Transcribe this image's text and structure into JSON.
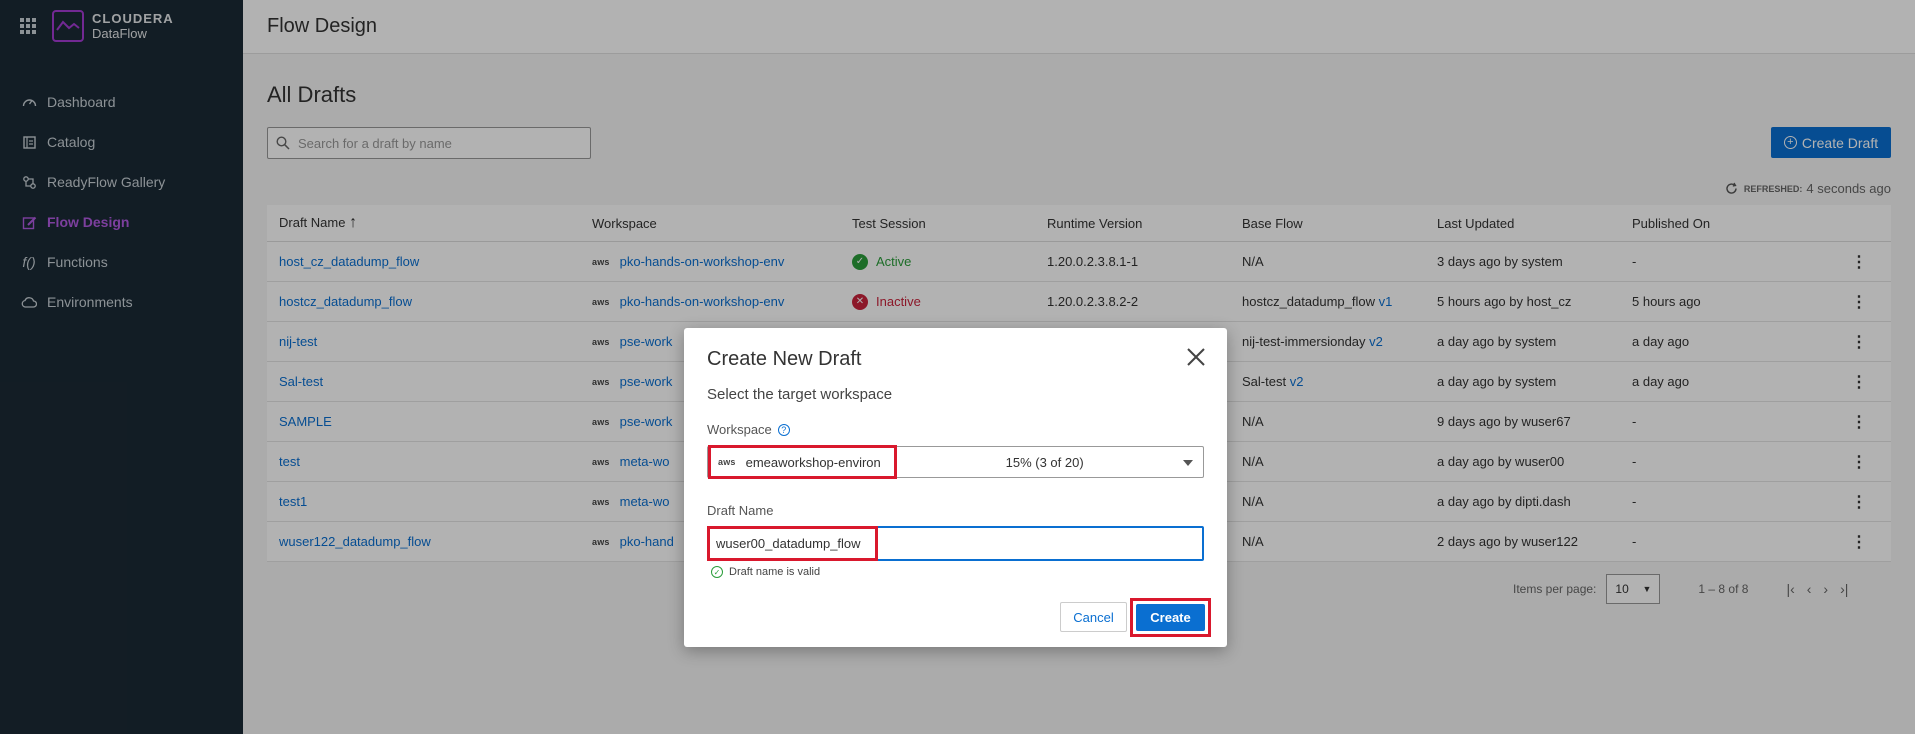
{
  "brand": {
    "name": "CLOUDERA",
    "product": "DataFlow"
  },
  "nav": [
    {
      "label": "Dashboard",
      "icon": "dashboard-icon"
    },
    {
      "label": "Catalog",
      "icon": "catalog-icon"
    },
    {
      "label": "ReadyFlow Gallery",
      "icon": "readyflow-icon"
    },
    {
      "label": "Flow Design",
      "icon": "flow-design-icon",
      "active": true
    },
    {
      "label": "Functions",
      "icon": "functions-icon"
    },
    {
      "label": "Environments",
      "icon": "cloud-icon"
    }
  ],
  "header": {
    "title": "Flow Design"
  },
  "section": {
    "title": "All Drafts"
  },
  "search": {
    "placeholder": "Search for a draft by name"
  },
  "create_draft_button": "Create Draft",
  "refreshed": {
    "label": "REFRESHED:",
    "value": "4 seconds ago"
  },
  "table": {
    "headers": [
      "Draft Name",
      "Workspace",
      "Test Session",
      "Runtime Version",
      "Base Flow",
      "Last Updated",
      "Published On"
    ],
    "sort_indicator": "↑",
    "rows": [
      {
        "name": "host_cz_datadump_flow",
        "workspace": "pko-hands-on-workshop-env",
        "test_session": "Active",
        "status": "active",
        "runtime": "1.20.0.2.3.8.1-1",
        "base_flow": "N/A",
        "base_flow_version": "",
        "last_updated": "3 days ago by system",
        "published_on": "-"
      },
      {
        "name": "hostcz_datadump_flow",
        "workspace": "pko-hands-on-workshop-env",
        "test_session": "Inactive",
        "status": "inactive",
        "runtime": "1.20.0.2.3.8.2-2",
        "base_flow": "hostcz_datadump_flow",
        "base_flow_version": "v1",
        "last_updated": "5 hours ago by host_cz",
        "published_on": "5 hours ago"
      },
      {
        "name": "nij-test",
        "workspace": "pse-work",
        "test_session": "",
        "status": "",
        "runtime": "",
        "base_flow": "nij-test-immersionday",
        "base_flow_version": "v2",
        "last_updated": "a day ago by system",
        "published_on": "a day ago"
      },
      {
        "name": "Sal-test",
        "workspace": "pse-work",
        "test_session": "",
        "status": "",
        "runtime": "",
        "base_flow": "Sal-test",
        "base_flow_version": "v2",
        "last_updated": "a day ago by system",
        "published_on": "a day ago"
      },
      {
        "name": "SAMPLE",
        "workspace": "pse-work",
        "test_session": "",
        "status": "",
        "runtime": "",
        "base_flow": "N/A",
        "base_flow_version": "",
        "last_updated": "9 days ago by wuser67",
        "published_on": "-"
      },
      {
        "name": "test",
        "workspace": "meta-wo",
        "test_session": "",
        "status": "",
        "runtime": "",
        "base_flow": "N/A",
        "base_flow_version": "",
        "last_updated": "a day ago by wuser00",
        "published_on": "-"
      },
      {
        "name": "test1",
        "workspace": "meta-wo",
        "test_session": "",
        "status": "",
        "runtime": "",
        "base_flow": "N/A",
        "base_flow_version": "",
        "last_updated": "a day ago by dipti.dash",
        "published_on": "-"
      },
      {
        "name": "wuser122_datadump_flow",
        "workspace": "pko-hand",
        "test_session": "",
        "status": "",
        "runtime": "",
        "base_flow": "N/A",
        "base_flow_version": "",
        "last_updated": "2 days ago by wuser122",
        "published_on": "-"
      }
    ]
  },
  "pagination": {
    "items_per_page_label": "Items per page:",
    "items_per_page": "10",
    "range": "1 – 8 of 8"
  },
  "modal": {
    "title": "Create New Draft",
    "subtitle": "Select the target workspace",
    "workspace_label": "Workspace",
    "workspace_value": "emeaworkshop-environ",
    "workspace_usage": "15% (3 of 20)",
    "draft_name_label": "Draft Name",
    "draft_name_value": "wuser00_datadump_flow",
    "validation": "Draft name is valid",
    "cancel": "Cancel",
    "create": "Create"
  },
  "colors": {
    "sidebar": "#1b2a35",
    "accent": "#0a6fd1",
    "active_nav": "#b25be3",
    "highlight": "#d9182d"
  }
}
